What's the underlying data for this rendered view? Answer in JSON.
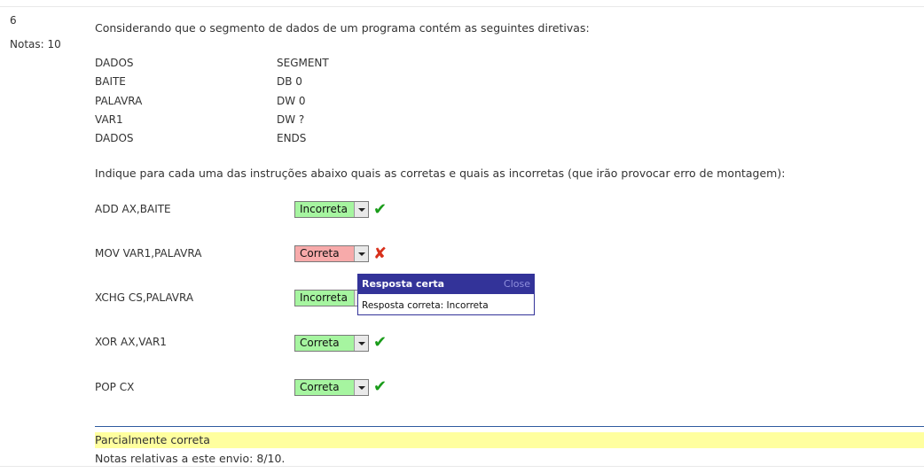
{
  "question": {
    "number": "6",
    "grade": "Notas: 10",
    "text": "Considerando que o segmento de dados de um programa contém as seguintes diretivas:"
  },
  "directives": [
    {
      "name": "DADOS",
      "value": "SEGMENT"
    },
    {
      "name": "BAITE",
      "value": "DB 0"
    },
    {
      "name": "PALAVRA",
      "value": "DW 0"
    },
    {
      "name": "VAR1",
      "value": "DW ?"
    },
    {
      "name": "DADOS",
      "value": "ENDS"
    }
  ],
  "instruction_prompt": "Indique para cada uma das instruções abaixo quais as corretas e quais as incorretas (que irão provocar erro de montagem):",
  "items": [
    {
      "label": "ADD AX,BAITE",
      "selected": "Incorreta",
      "result": "correct"
    },
    {
      "label": "MOV VAR1,PALAVRA",
      "selected": "Correta",
      "result": "wrong"
    },
    {
      "label": "XCHG CS,PALAVRA",
      "selected": "Incorreta",
      "result": "hidden"
    },
    {
      "label": "XOR AX,VAR1",
      "selected": "Correta",
      "result": "correct"
    },
    {
      "label": "POP CX",
      "selected": "Correta",
      "result": "correct"
    }
  ],
  "popup": {
    "title": "Resposta certa",
    "close": "Close",
    "body": "Resposta correta: Incorreta"
  },
  "feedback": {
    "status": "Parcialmente correta",
    "notes": "Notas relativas a este envio: 8/10."
  },
  "colors": {
    "correct_bg": "#a6f5a0",
    "wrong_bg": "#f7aaaa",
    "popup_header": "#333399",
    "feedback_bg": "#ffff9f"
  }
}
